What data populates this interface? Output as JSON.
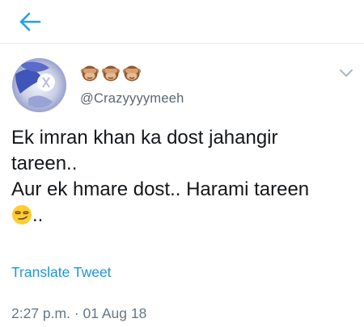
{
  "header": {
    "back_icon": "back-arrow-icon",
    "accent_color": "#1da1f2"
  },
  "tweet": {
    "display_name_emojis": [
      "see-no-evil-monkey",
      "see-no-evil-monkey",
      "see-no-evil-monkey"
    ],
    "handle": "@Crazyyyymeeh",
    "text_lines": [
      "Ek imran khan ka dost jahangir",
      "tareen..",
      "Aur ek hmare dost.. Harami tareen"
    ],
    "text_tail": "..",
    "tail_emoji": "smirking-face",
    "translate_label": "Translate Tweet",
    "timestamp": "2:27 p.m. · 01 Aug 18",
    "link_color": "#1b95e0",
    "menu_icon": "chevron-down-icon"
  }
}
